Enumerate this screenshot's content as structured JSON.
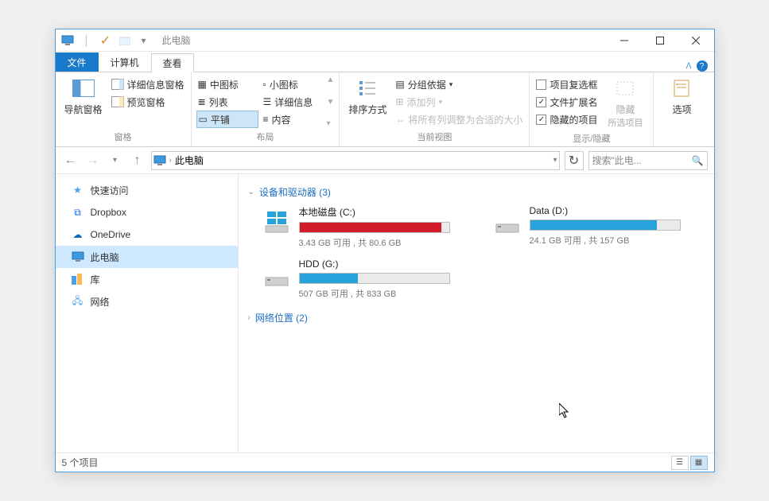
{
  "titlebar": {
    "title": "此电脑"
  },
  "tabs": {
    "file": "文件",
    "computer": "计算机",
    "view": "查看"
  },
  "ribbon": {
    "panes": {
      "nav_pane": "导航窗格",
      "preview_pane": "预览窗格",
      "group": "窗格"
    },
    "layout": {
      "medium": "中图标",
      "small": "小图标",
      "list": "列表",
      "details": "详细信息",
      "tiles": "平铺",
      "content": "内容",
      "group": "布局"
    },
    "current_view": {
      "sort": "排序方式",
      "group_by": "分组依据",
      "add_column": "添加列",
      "fit_columns": "将所有列调整为合适的大小",
      "group": "当前视图"
    },
    "show_hide": {
      "item_checkboxes": "项目复选框",
      "extensions": "文件扩展名",
      "hidden_items": "隐藏的项目",
      "hide": "隐藏",
      "hide_sub": "所选项目",
      "group": "显示/隐藏"
    },
    "options": {
      "label": "选项"
    }
  },
  "address": {
    "location": "此电脑"
  },
  "search": {
    "placeholder": "搜索\"此电..."
  },
  "sidebar": {
    "quick_access": "快速访问",
    "dropbox": "Dropbox",
    "onedrive": "OneDrive",
    "this_pc": "此电脑",
    "libraries": "库",
    "network": "网络"
  },
  "content": {
    "group_devices": "设备和驱动器 (3)",
    "group_network": "网络位置 (2)",
    "drives": [
      {
        "name": "本地磁盘 (C:)",
        "text": "3.43 GB 可用 , 共 80.6 GB",
        "fill_pct": 95,
        "color": "#d11a2a",
        "type": "os"
      },
      {
        "name": "Data (D:)",
        "text": "24.1 GB 可用 , 共 157 GB",
        "fill_pct": 85,
        "color": "#27a2db",
        "type": "hdd"
      },
      {
        "name": "HDD (G:)",
        "text": "507 GB 可用 , 共 833 GB",
        "fill_pct": 39,
        "color": "#27a2db",
        "type": "hdd"
      }
    ]
  },
  "statusbar": {
    "items": "5 个项目"
  }
}
